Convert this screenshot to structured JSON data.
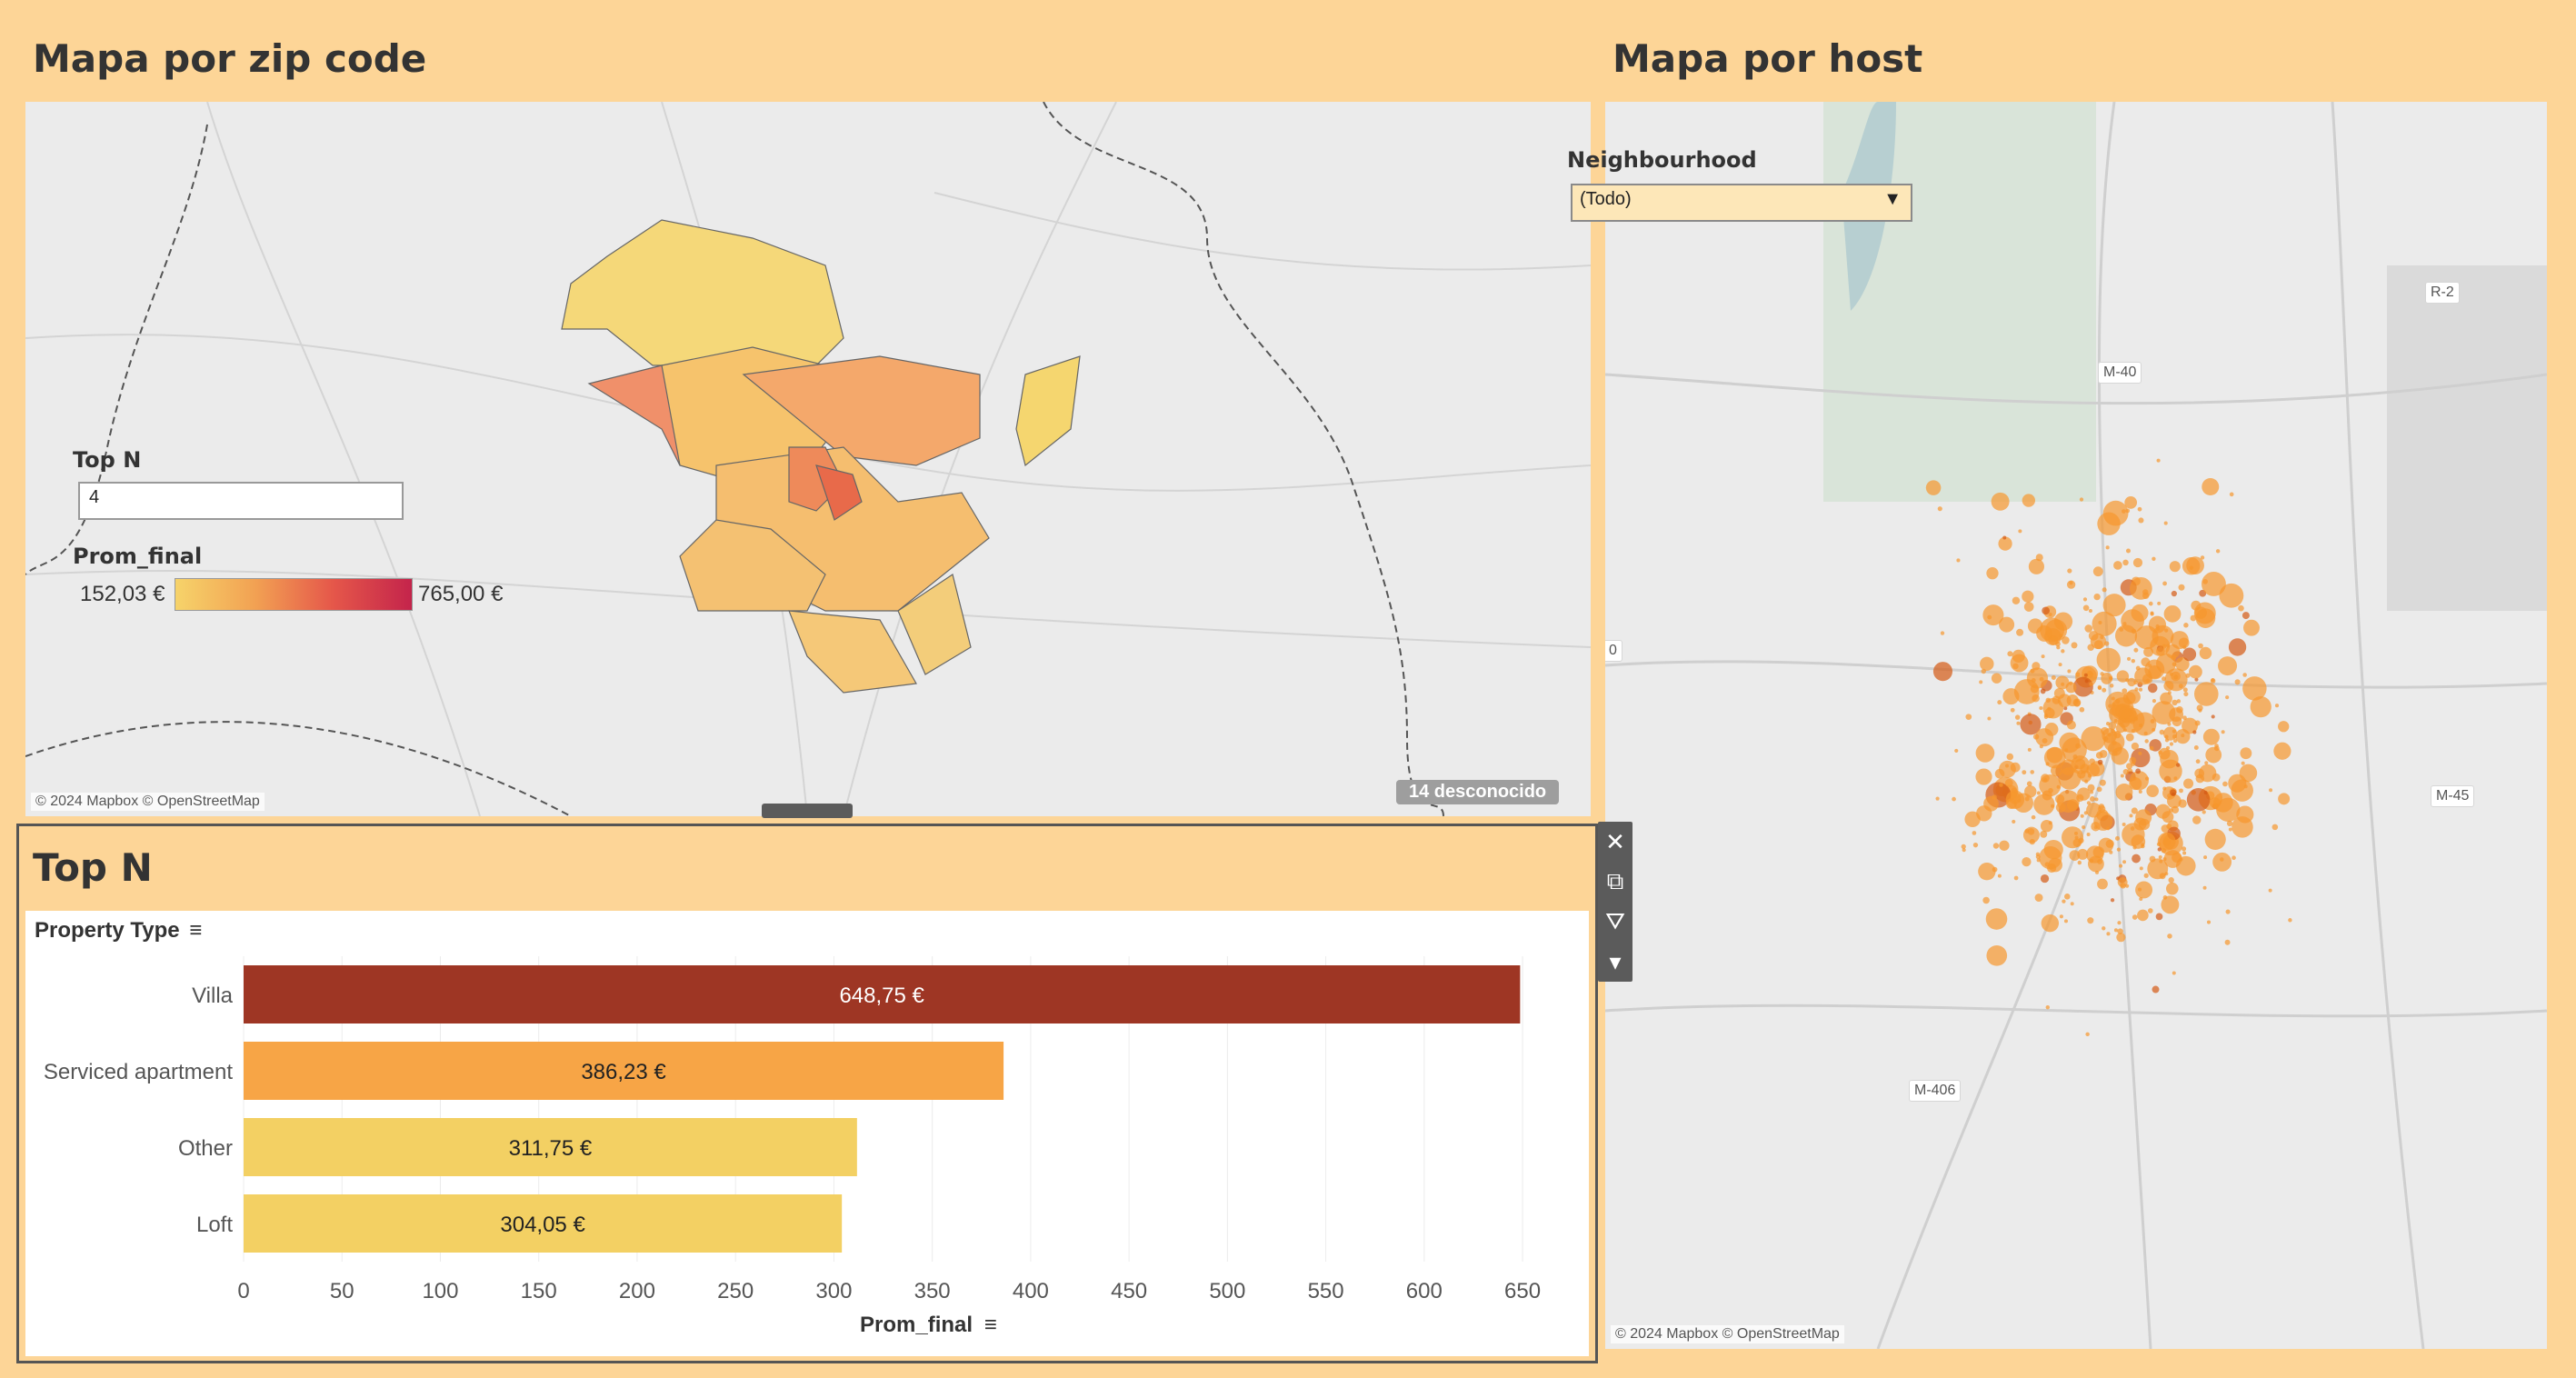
{
  "left_map": {
    "title": "Mapa por zip code",
    "attribution": "© 2024 Mapbox © OpenStreetMap",
    "unknown_badge": "14 desconocido",
    "topn_label": "Top N",
    "topn_value": "4",
    "legend": {
      "title": "Prom_final",
      "min": "152,03 €",
      "max": "765,00 €",
      "color_low": "#f5d36b",
      "color_high": "#c4244b"
    }
  },
  "right_map": {
    "title": "Mapa por host",
    "attribution": "© 2024 Mapbox © OpenStreetMap",
    "filter_label": "Neighbourhood",
    "filter_value": "(Todo)",
    "road_labels": [
      "R-2",
      "M-40",
      "M-45",
      "M-406",
      "0"
    ],
    "dot_color": "#f7972e"
  },
  "topn_panel": {
    "title": "Top N",
    "sort_field": "Property Type",
    "x_axis_title": "Prom_final",
    "toolbar_icons": [
      "close-icon",
      "popout-icon",
      "filter-icon",
      "more-icon"
    ]
  },
  "chart_data": {
    "type": "bar",
    "orientation": "horizontal",
    "categories": [
      "Villa",
      "Serviced apartment",
      "Other",
      "Loft"
    ],
    "values": [
      648.75,
      386.23,
      311.75,
      304.05
    ],
    "value_labels": [
      "648,75 €",
      "386,23 €",
      "311,75 €",
      "304,05 €"
    ],
    "colors": [
      "#9e3624",
      "#f7a546",
      "#f3d063",
      "#f3d063"
    ],
    "label_colors": [
      "#ffffff",
      "#222222",
      "#222222",
      "#222222"
    ],
    "xlim": [
      0,
      680
    ],
    "xticks": [
      0,
      50,
      100,
      150,
      200,
      250,
      300,
      350,
      400,
      450,
      500,
      550,
      600,
      650
    ],
    "xlabel": "Prom_final",
    "ylabel": "Property Type",
    "grid": true
  }
}
